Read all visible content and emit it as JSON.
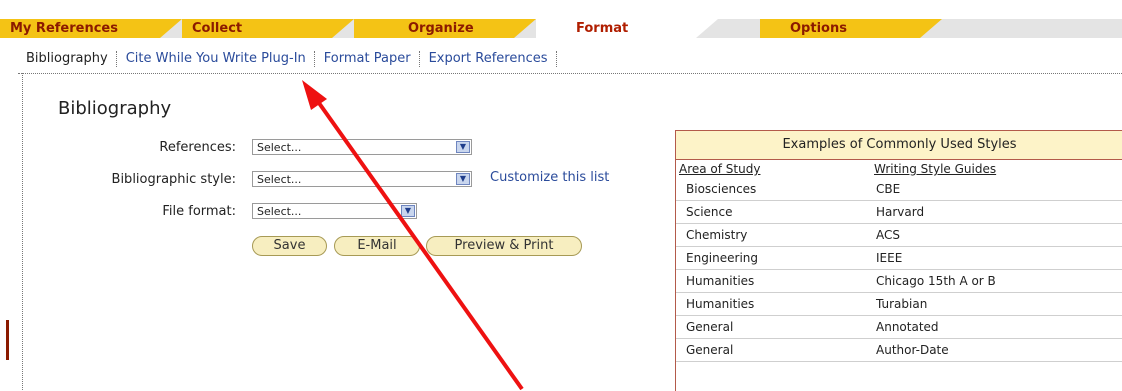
{
  "tabs": [
    {
      "label": "My References"
    },
    {
      "label": "Collect"
    },
    {
      "label": "Organize"
    },
    {
      "label": "Format"
    },
    {
      "label": "Options"
    }
  ],
  "submenu": {
    "bibliography": "Bibliography",
    "cwyw": "Cite While You Write Plug-In",
    "format_paper": "Format Paper",
    "export": "Export References"
  },
  "form": {
    "heading": "Bibliography",
    "references_label": "References:",
    "references_value": "Select...",
    "style_label": "Bibliographic style:",
    "style_value": "Select...",
    "customize": "Customize this list",
    "fileformat_label": "File format:",
    "fileformat_value": "Select...",
    "save": "Save",
    "email": "E-Mail",
    "preview": "Preview & Print"
  },
  "examples": {
    "title": "Examples of Commonly Used Styles",
    "col1": "Area of Study",
    "col2": "Writing Style Guides",
    "rows": [
      [
        "Biosciences",
        "CBE"
      ],
      [
        "Science",
        "Harvard"
      ],
      [
        "Chemistry",
        "ACS"
      ],
      [
        "Engineering",
        "IEEE"
      ],
      [
        "Humanities",
        "Chicago 15th A or B"
      ],
      [
        "Humanities",
        "Turabian"
      ],
      [
        "General",
        "Annotated"
      ],
      [
        "General",
        "Author-Date"
      ]
    ]
  },
  "colors": {
    "tab_yellow": "#f4c315",
    "tab_text": "#8b1a00",
    "link": "#2a4b9b",
    "annotation_arrow": "#ee1111"
  }
}
